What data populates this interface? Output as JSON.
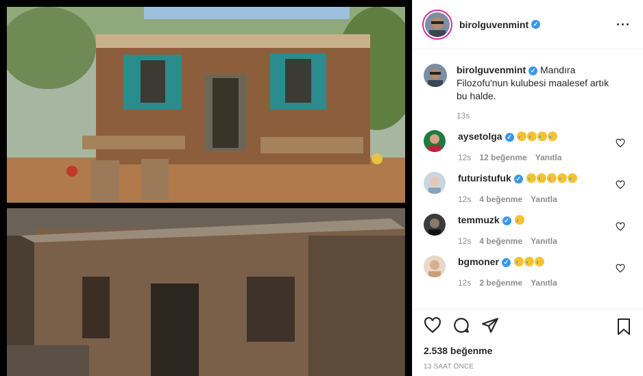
{
  "post": {
    "author": "birolguvenmint",
    "more_icon": "more-horizontal-icon",
    "caption": "Mandıra Filozofu'nun kulubesi maalesef artık bu halde.",
    "caption_time": "13s",
    "likes": "2.538 beğenme",
    "posted": "13 SAAT ÖNCE"
  },
  "comments": [
    {
      "user": "aysetolga",
      "emoji_count": 4,
      "time": "12s",
      "likes": "12 beğenme",
      "reply": "Yanıtla"
    },
    {
      "user": "futuristufuk",
      "emoji_count": 5,
      "time": "12s",
      "likes": "4 beğenme",
      "reply": "Yanıtla"
    },
    {
      "user": "temmuzk",
      "emoji_count": 1,
      "time": "12s",
      "likes": "4 beğenme",
      "reply": "Yanıtla"
    },
    {
      "user": "bgmoner",
      "emoji_count": 3,
      "time": "12s",
      "likes": "2 beğenme",
      "reply": "Yanıtla"
    }
  ],
  "colors": {
    "accent": "#3897f0",
    "text": "#262626",
    "muted": "#8e8e8e"
  }
}
